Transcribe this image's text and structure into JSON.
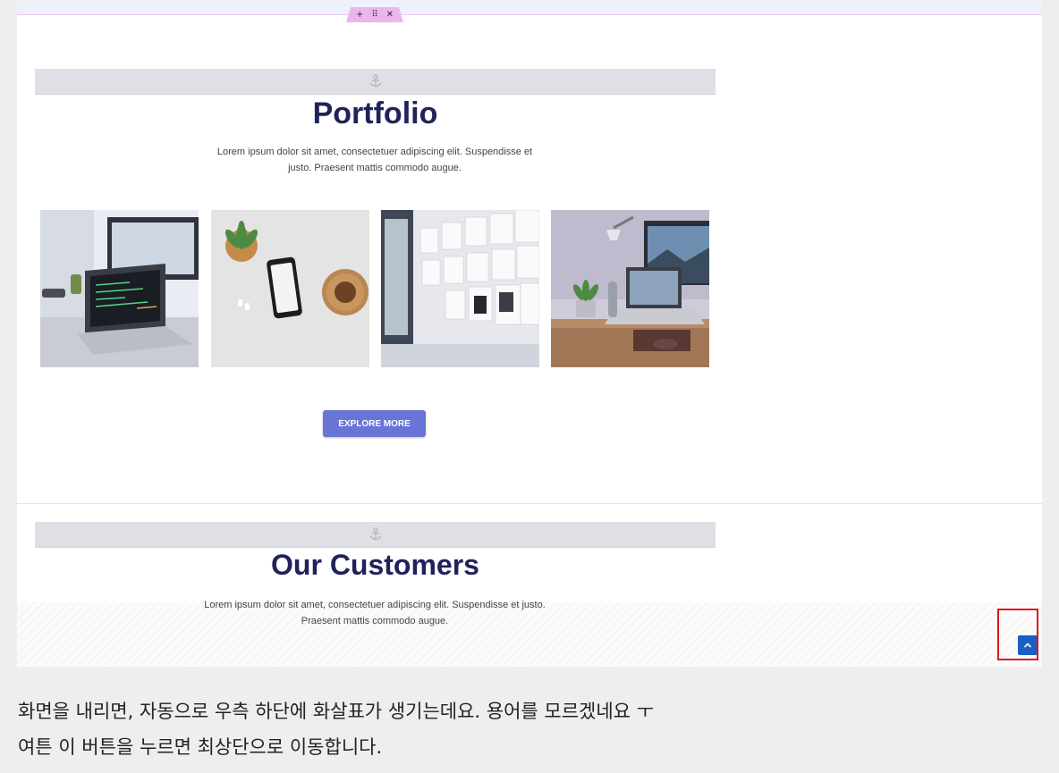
{
  "editor": {
    "handle_icons": [
      "plus-icon",
      "drag-handle-icon",
      "close-icon"
    ]
  },
  "portfolio": {
    "title": "Portfolio",
    "description_line1": "Lorem ipsum dolor sit amet, consectetuer adipiscing elit. Suspendisse et",
    "description_line2": "justo. Praesent mattis commodo augue.",
    "images": [
      "laptop-desk-photo",
      "phone-plant-photo",
      "wall-sketches-photo",
      "workspace-laptop-photo"
    ],
    "button_label": "EXPLORE MORE"
  },
  "customers": {
    "title": "Our Customers",
    "description_line1": "Lorem ipsum dolor sit amet, consectetuer adipiscing elit. Suspendisse et justo.",
    "description_line2": "Praesent mattis commodo augue."
  },
  "scroll_to_top": {
    "icon": "chevron-up-icon"
  },
  "caption": {
    "line1": "화면을 내리면, 자동으로 우측 하단에 화살표가 생기는데요. 용어를 모르겠네요 ㅜ",
    "line2": "여튼 이 버튼을 누르면 최상단으로 이동합니다."
  },
  "colors": {
    "title": "#20235a",
    "button": "#6875d7",
    "scroll_button": "#1a5fc4",
    "highlight": "#e0161b"
  }
}
